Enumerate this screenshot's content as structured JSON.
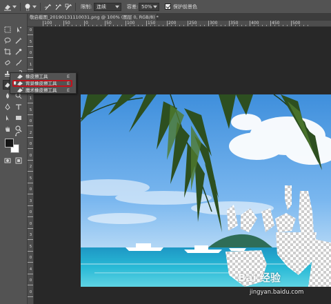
{
  "options_bar": {
    "limits_label": "限制:",
    "limits_value": "连续",
    "tolerance_label": "容差:",
    "tolerance_value": "50%",
    "protect_fg_label": "保护前景色",
    "protect_fg_checked": true
  },
  "document": {
    "tab_title": "敬启截图_20190131110031.png @ 100% (图层 0, RGB/8) *",
    "tab_close": "×"
  },
  "rulers": {
    "top": [
      "100",
      "50",
      "0",
      "50",
      "100",
      "150",
      "200",
      "250",
      "300",
      "350",
      "400",
      "450",
      "500"
    ],
    "left": [
      "0",
      "5",
      "0",
      "1",
      "0",
      "0",
      "1",
      "5",
      "0",
      "2",
      "0",
      "0",
      "2",
      "5",
      "0",
      "3",
      "0",
      "0",
      "3",
      "5",
      "0",
      "4",
      "0",
      "0"
    ]
  },
  "eraser_flyout": {
    "items": [
      {
        "label": "橡皮擦工具",
        "shortcut": "E",
        "selected": false
      },
      {
        "label": "背景橡皮擦工具",
        "shortcut": "E",
        "selected": true
      },
      {
        "label": "魔术橡皮擦工具",
        "shortcut": "E",
        "selected": false
      }
    ]
  },
  "colors": {
    "foreground": "#151515",
    "background": "#ffffff",
    "panel": "#535353",
    "workspace": "#282828",
    "highlight": "#c0121c"
  },
  "icons": [
    "background-eraser-icon",
    "brush-preset-icon",
    "sampling-continuous-icon",
    "sampling-once-icon",
    "sampling-swatch-icon"
  ],
  "watermark": {
    "logo": "Bai 经验",
    "url": "jingyan.baidu.com"
  }
}
